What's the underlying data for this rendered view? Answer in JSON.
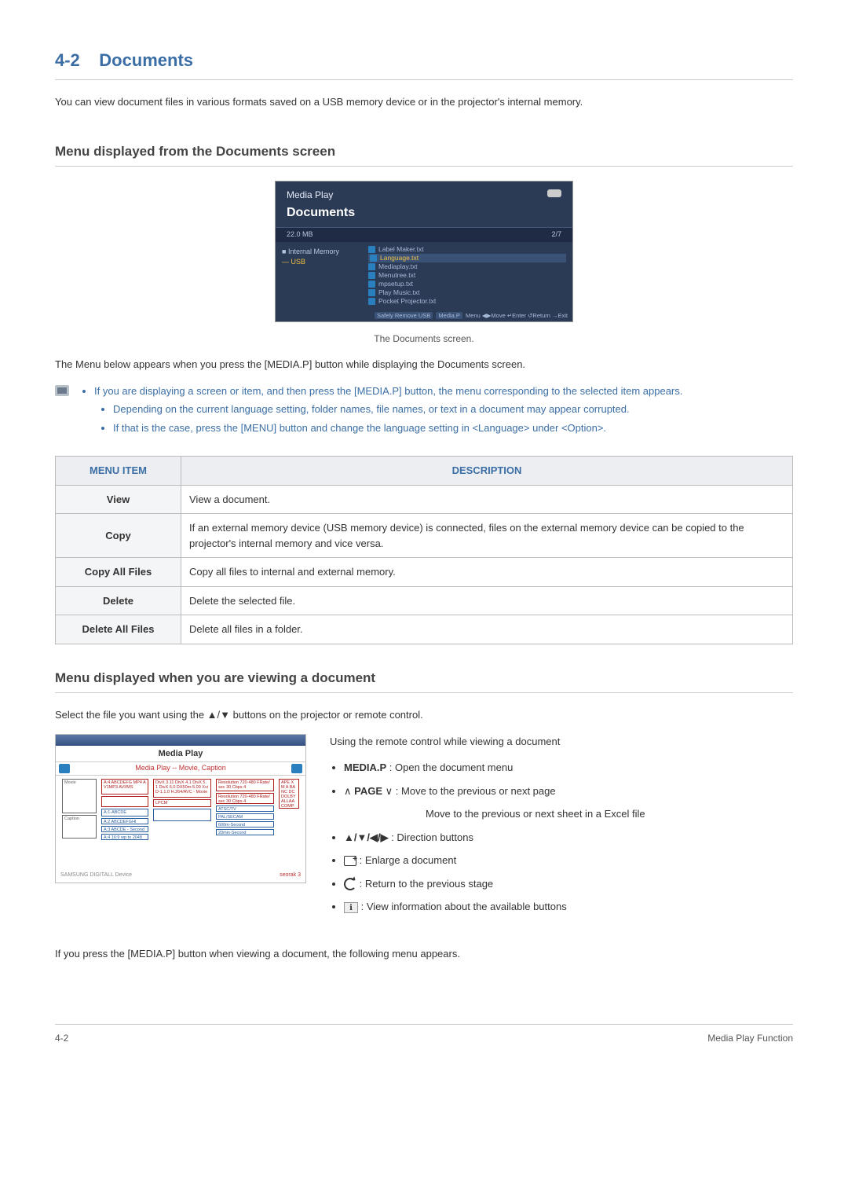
{
  "section": {
    "number": "4-2",
    "title": "Documents"
  },
  "intro": "You can view document files in various formats saved on a USB memory device or in the projector's internal memory.",
  "sub1": {
    "title": "Menu displayed from the Documents screen",
    "screenshot": {
      "mediaplay": "Media Play",
      "documents": "Documents",
      "size": "22.0 MB",
      "count": "2/7",
      "left": {
        "internal": "Internal Memory",
        "usb": "USB"
      },
      "files": [
        "Label Maker.txt",
        "Language.txt",
        "Mediaplay.txt",
        "Menutree.txt",
        "mpsetup.txt",
        "Play Music.txt",
        "Pocket Projector.txt"
      ],
      "footer_left": "Safely Remove USB",
      "footer_menu": "Media.P",
      "footer_rest": "Menu ◀▶Move ↵Enter ↺Return →Exit"
    },
    "caption": "The Documents screen.",
    "menu_intro": "The Menu below appears when you press the [MEDIA.P] button while displaying the Documents screen.",
    "note_main": "If you are displaying a screen or item, and then press the [MEDIA.P] button, the menu corresponding to the selected item appears.",
    "note_sub1": "Depending on the current language setting, folder names, file names, or text in a document may appear corrupted.",
    "note_sub2": "If that is the case, press the [MENU] button and change the language setting in <Language> under <Option>."
  },
  "table": {
    "head_item": "MENU ITEM",
    "head_desc": "DESCRIPTION",
    "rows": [
      {
        "item": "View",
        "desc": "View a document."
      },
      {
        "item": "Copy",
        "desc": "If an external memory device (USB memory device) is connected, files on the external memory device can be copied to the projector's internal memory and vice versa."
      },
      {
        "item": "Copy All Files",
        "desc": "Copy all files to internal and external memory."
      },
      {
        "item": "Delete",
        "desc": "Delete the selected file."
      },
      {
        "item": "Delete All Files",
        "desc": "Delete all files in a folder."
      }
    ]
  },
  "sub2": {
    "title": "Menu displayed when you are viewing a document",
    "intro": "Select the file you want using the ▲/▼ buttons on the projector or remote control.",
    "screenshot": {
      "mediaplay": "Media Play",
      "subtitle": "Media Play -- Movie, Caption",
      "foot_left": "SAMSUNG DIGITALL Device",
      "foot_right": "seorak 3"
    },
    "rc_heading": "Using the remote control while viewing a document",
    "items": {
      "mediap_label": "MEDIA.P",
      "mediap_desc": " : Open the document menu",
      "page_label": "PAGE",
      "page_left": "∧",
      "page_right": "∨",
      "page_colon": " : ",
      "page_desc": "Move to the previous or next page",
      "page_desc2": "Move to the previous or next sheet in a Excel file",
      "dir_label": "▲/▼/◀/▶",
      "dir_desc": " : Direction buttons",
      "enlarge_desc": " : Enlarge a document",
      "return_desc": " : Return to the previous stage",
      "info_desc": " : View information about the available buttons"
    },
    "outro": "If you press the [MEDIA.P] button when viewing a document, the following menu appears."
  },
  "footer": {
    "left": "4-2",
    "right": "Media Play Function"
  }
}
